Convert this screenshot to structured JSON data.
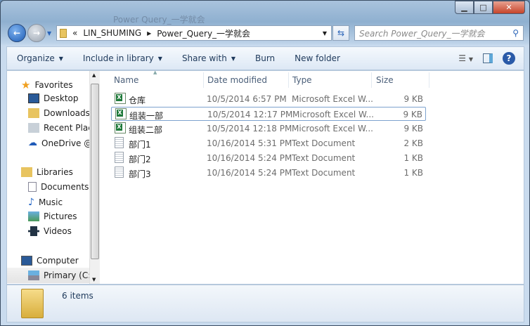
{
  "window": {
    "title": "Power Query_一学就会"
  },
  "address": {
    "overflow": "«",
    "crumbs": [
      "LIN_SHUMING",
      "Power_Query_一学就会"
    ],
    "search_placeholder": "Search Power_Query_一学就会"
  },
  "toolbar": {
    "organize": "Organize",
    "include": "Include in library",
    "share": "Share with",
    "burn": "Burn",
    "new_folder": "New folder"
  },
  "sidebar": {
    "favorites": "Favorites",
    "fav_items": [
      "Desktop",
      "Downloads",
      "Recent Places",
      "OneDrive @"
    ],
    "libraries": "Libraries",
    "lib_items": [
      "Documents",
      "Music",
      "Pictures",
      "Videos"
    ],
    "computer": "Computer",
    "comp_items": [
      "Primary (C:)"
    ]
  },
  "columns": {
    "name": "Name",
    "date": "Date modified",
    "type": "Type",
    "size": "Size"
  },
  "files": [
    {
      "name": "仓库",
      "date": "10/5/2014 6:57 PM",
      "type": "Microsoft Excel W...",
      "size": "9 KB",
      "icon": "excel"
    },
    {
      "name": "组装一部",
      "date": "10/5/2014 12:17 PM",
      "type": "Microsoft Excel W...",
      "size": "9 KB",
      "icon": "excel"
    },
    {
      "name": "组装二部",
      "date": "10/5/2014 12:18 PM",
      "type": "Microsoft Excel W...",
      "size": "9 KB",
      "icon": "excel"
    },
    {
      "name": "部门1",
      "date": "10/16/2014 5:31 PM",
      "type": "Text Document",
      "size": "2 KB",
      "icon": "text"
    },
    {
      "name": "部门2",
      "date": "10/16/2014 5:24 PM",
      "type": "Text Document",
      "size": "1 KB",
      "icon": "text"
    },
    {
      "name": "部门3",
      "date": "10/16/2014 5:24 PM",
      "type": "Text Document",
      "size": "1 KB",
      "icon": "text"
    }
  ],
  "status": {
    "count": "6 items"
  }
}
